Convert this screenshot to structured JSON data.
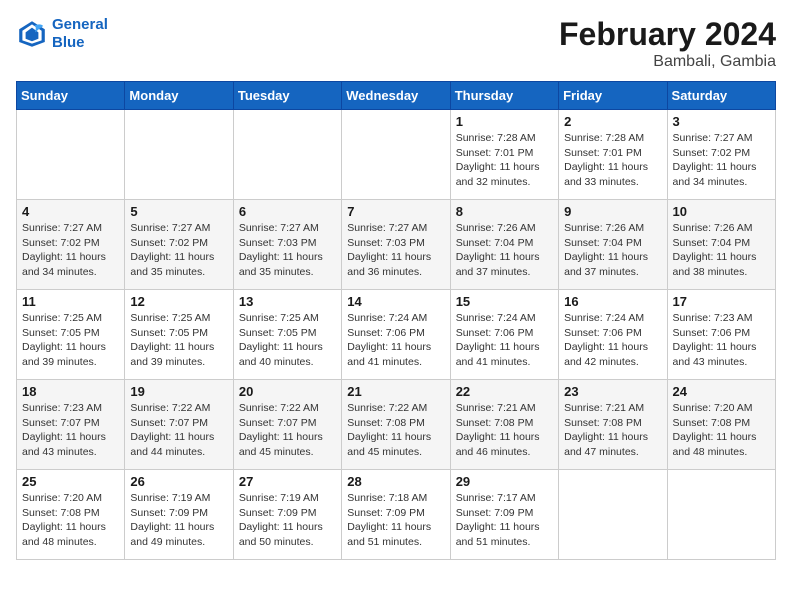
{
  "header": {
    "logo_line1": "General",
    "logo_line2": "Blue",
    "month_year": "February 2024",
    "location": "Bambali, Gambia"
  },
  "weekdays": [
    "Sunday",
    "Monday",
    "Tuesday",
    "Wednesday",
    "Thursday",
    "Friday",
    "Saturday"
  ],
  "weeks": [
    [
      {
        "day": "",
        "info": ""
      },
      {
        "day": "",
        "info": ""
      },
      {
        "day": "",
        "info": ""
      },
      {
        "day": "",
        "info": ""
      },
      {
        "day": "1",
        "info": "Sunrise: 7:28 AM\nSunset: 7:01 PM\nDaylight: 11 hours and 32 minutes."
      },
      {
        "day": "2",
        "info": "Sunrise: 7:28 AM\nSunset: 7:01 PM\nDaylight: 11 hours and 33 minutes."
      },
      {
        "day": "3",
        "info": "Sunrise: 7:27 AM\nSunset: 7:02 PM\nDaylight: 11 hours and 34 minutes."
      }
    ],
    [
      {
        "day": "4",
        "info": "Sunrise: 7:27 AM\nSunset: 7:02 PM\nDaylight: 11 hours and 34 minutes."
      },
      {
        "day": "5",
        "info": "Sunrise: 7:27 AM\nSunset: 7:02 PM\nDaylight: 11 hours and 35 minutes."
      },
      {
        "day": "6",
        "info": "Sunrise: 7:27 AM\nSunset: 7:03 PM\nDaylight: 11 hours and 35 minutes."
      },
      {
        "day": "7",
        "info": "Sunrise: 7:27 AM\nSunset: 7:03 PM\nDaylight: 11 hours and 36 minutes."
      },
      {
        "day": "8",
        "info": "Sunrise: 7:26 AM\nSunset: 7:04 PM\nDaylight: 11 hours and 37 minutes."
      },
      {
        "day": "9",
        "info": "Sunrise: 7:26 AM\nSunset: 7:04 PM\nDaylight: 11 hours and 37 minutes."
      },
      {
        "day": "10",
        "info": "Sunrise: 7:26 AM\nSunset: 7:04 PM\nDaylight: 11 hours and 38 minutes."
      }
    ],
    [
      {
        "day": "11",
        "info": "Sunrise: 7:25 AM\nSunset: 7:05 PM\nDaylight: 11 hours and 39 minutes."
      },
      {
        "day": "12",
        "info": "Sunrise: 7:25 AM\nSunset: 7:05 PM\nDaylight: 11 hours and 39 minutes."
      },
      {
        "day": "13",
        "info": "Sunrise: 7:25 AM\nSunset: 7:05 PM\nDaylight: 11 hours and 40 minutes."
      },
      {
        "day": "14",
        "info": "Sunrise: 7:24 AM\nSunset: 7:06 PM\nDaylight: 11 hours and 41 minutes."
      },
      {
        "day": "15",
        "info": "Sunrise: 7:24 AM\nSunset: 7:06 PM\nDaylight: 11 hours and 41 minutes."
      },
      {
        "day": "16",
        "info": "Sunrise: 7:24 AM\nSunset: 7:06 PM\nDaylight: 11 hours and 42 minutes."
      },
      {
        "day": "17",
        "info": "Sunrise: 7:23 AM\nSunset: 7:06 PM\nDaylight: 11 hours and 43 minutes."
      }
    ],
    [
      {
        "day": "18",
        "info": "Sunrise: 7:23 AM\nSunset: 7:07 PM\nDaylight: 11 hours and 43 minutes."
      },
      {
        "day": "19",
        "info": "Sunrise: 7:22 AM\nSunset: 7:07 PM\nDaylight: 11 hours and 44 minutes."
      },
      {
        "day": "20",
        "info": "Sunrise: 7:22 AM\nSunset: 7:07 PM\nDaylight: 11 hours and 45 minutes."
      },
      {
        "day": "21",
        "info": "Sunrise: 7:22 AM\nSunset: 7:08 PM\nDaylight: 11 hours and 45 minutes."
      },
      {
        "day": "22",
        "info": "Sunrise: 7:21 AM\nSunset: 7:08 PM\nDaylight: 11 hours and 46 minutes."
      },
      {
        "day": "23",
        "info": "Sunrise: 7:21 AM\nSunset: 7:08 PM\nDaylight: 11 hours and 47 minutes."
      },
      {
        "day": "24",
        "info": "Sunrise: 7:20 AM\nSunset: 7:08 PM\nDaylight: 11 hours and 48 minutes."
      }
    ],
    [
      {
        "day": "25",
        "info": "Sunrise: 7:20 AM\nSunset: 7:08 PM\nDaylight: 11 hours and 48 minutes."
      },
      {
        "day": "26",
        "info": "Sunrise: 7:19 AM\nSunset: 7:09 PM\nDaylight: 11 hours and 49 minutes."
      },
      {
        "day": "27",
        "info": "Sunrise: 7:19 AM\nSunset: 7:09 PM\nDaylight: 11 hours and 50 minutes."
      },
      {
        "day": "28",
        "info": "Sunrise: 7:18 AM\nSunset: 7:09 PM\nDaylight: 11 hours and 51 minutes."
      },
      {
        "day": "29",
        "info": "Sunrise: 7:17 AM\nSunset: 7:09 PM\nDaylight: 11 hours and 51 minutes."
      },
      {
        "day": "",
        "info": ""
      },
      {
        "day": "",
        "info": ""
      }
    ]
  ]
}
